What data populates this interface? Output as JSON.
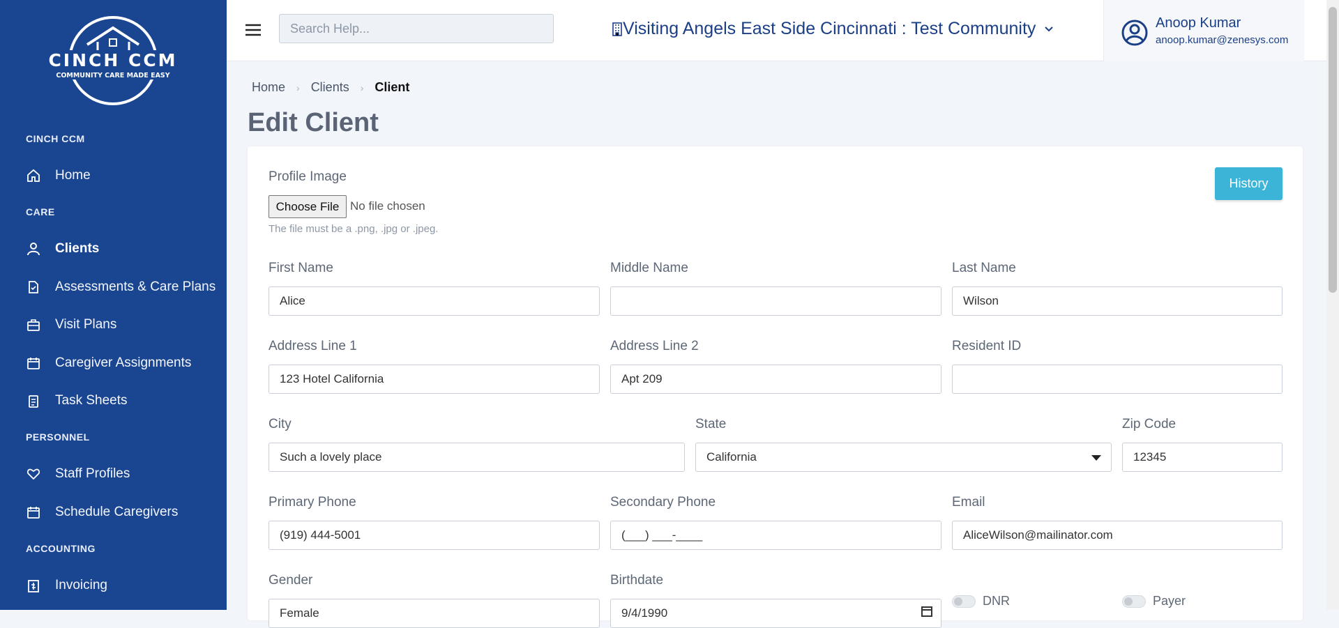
{
  "brand": {
    "logo_title": "CINCH CCM",
    "logo_tagline": "COMMUNITY CARE MADE EASY"
  },
  "sidebar": {
    "sections": [
      {
        "title": "CINCH CCM",
        "items": [
          {
            "label": "Home",
            "icon": "home-icon"
          }
        ]
      },
      {
        "title": "CARE",
        "items": [
          {
            "label": "Clients",
            "icon": "user-icon",
            "active": true
          },
          {
            "label": "Assessments & Care Plans",
            "icon": "document-icon"
          },
          {
            "label": "Visit Plans",
            "icon": "briefcase-icon"
          },
          {
            "label": "Caregiver Assignments",
            "icon": "calendar-icon"
          },
          {
            "label": "Task Sheets",
            "icon": "clipboard-icon"
          }
        ]
      },
      {
        "title": "PERSONNEL",
        "items": [
          {
            "label": "Staff Profiles",
            "icon": "heart-icon"
          },
          {
            "label": "Schedule Caregivers",
            "icon": "calendar-icon"
          }
        ]
      },
      {
        "title": "ACCOUNTING",
        "items": [
          {
            "label": "Invoicing",
            "icon": "invoice-icon"
          }
        ]
      }
    ]
  },
  "header": {
    "search_placeholder": "Search Help...",
    "community": "Visiting Angels East Side Cincinnati : Test Community",
    "user_name": "Anoop Kumar",
    "user_email": "anoop.kumar@zenesys.com"
  },
  "breadcrumb": [
    "Home",
    "Clients",
    "Client"
  ],
  "page_title": "Edit Client",
  "form": {
    "profile_image_label": "Profile Image",
    "choose_file": "Choose File",
    "no_file": "No file chosen",
    "file_hint": "The file must be a .png, .jpg or .jpeg.",
    "history_button": "History",
    "first_name": {
      "label": "First Name",
      "value": "Alice"
    },
    "middle_name": {
      "label": "Middle Name",
      "value": ""
    },
    "last_name": {
      "label": "Last Name",
      "value": "Wilson"
    },
    "address1": {
      "label": "Address Line 1",
      "value": "123 Hotel California"
    },
    "address2": {
      "label": "Address Line 2",
      "value": "Apt 209"
    },
    "resident_id": {
      "label": "Resident ID",
      "value": ""
    },
    "city": {
      "label": "City",
      "value": "Such a lovely place"
    },
    "state": {
      "label": "State",
      "value": "California"
    },
    "zip": {
      "label": "Zip Code",
      "value": "12345"
    },
    "primary_phone": {
      "label": "Primary Phone",
      "value": "(919) 444-5001"
    },
    "secondary_phone": {
      "label": "Secondary Phone",
      "value": "(___) ___-____"
    },
    "email": {
      "label": "Email",
      "value": "AliceWilson@mailinator.com"
    },
    "gender": {
      "label": "Gender",
      "value": "Female"
    },
    "birthdate": {
      "label": "Birthdate",
      "value": "9/4/1990"
    },
    "dnr": {
      "label": "DNR"
    },
    "payer": {
      "label": "Payer"
    }
  },
  "colors": {
    "sidebar": "#1a4591",
    "accent": "#3bb4d8",
    "text": "#4a5668"
  }
}
